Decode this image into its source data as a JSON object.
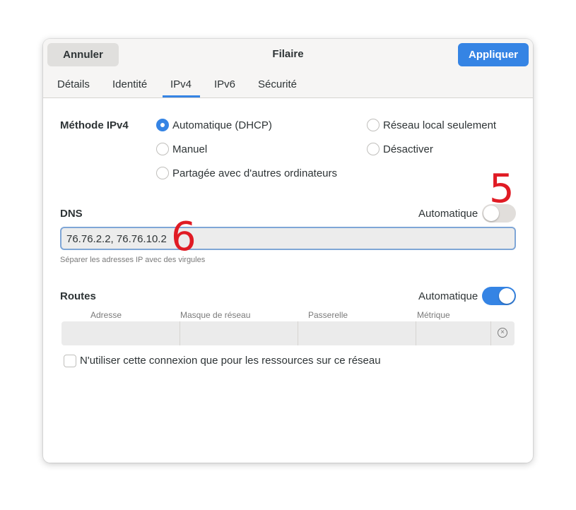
{
  "header": {
    "cancel_label": "Annuler",
    "title": "Filaire",
    "apply_label": "Appliquer"
  },
  "tabs": [
    {
      "label": "Détails"
    },
    {
      "label": "Identité"
    },
    {
      "label": "IPv4",
      "active": true
    },
    {
      "label": "IPv6"
    },
    {
      "label": "Sécurité"
    }
  ],
  "ipv4_method": {
    "label": "Méthode IPv4",
    "options": [
      {
        "label": "Automatique (DHCP)",
        "checked": true
      },
      {
        "label": "Réseau local seulement",
        "checked": false
      },
      {
        "label": "Manuel",
        "checked": false
      },
      {
        "label": "Désactiver",
        "checked": false
      },
      {
        "label": "Partagée avec d'autres ordinateurs",
        "checked": false
      }
    ]
  },
  "dns": {
    "label": "DNS",
    "auto_label": "Automatique",
    "auto_on": false,
    "value": "76.76.2.2, 76.76.10.2",
    "hint": "Séparer les adresses IP avec des virgules"
  },
  "routes": {
    "label": "Routes",
    "auto_label": "Automatique",
    "auto_on": true,
    "columns": [
      "Adresse",
      "Masque de réseau",
      "Passerelle",
      "Métrique"
    ]
  },
  "checkbox_label": "N'utiliser cette connexion que pour les ressources sur ce réseau",
  "annotations": [
    "5",
    "6"
  ],
  "colors": {
    "accent": "#3584e4",
    "annotation": "#e01b24"
  }
}
